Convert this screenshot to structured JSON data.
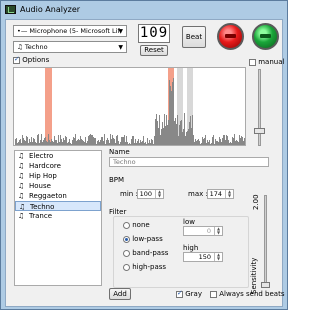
{
  "window": {
    "title": "Audio Analyzer"
  },
  "toolbar": {
    "input_device": "Microphone (5- Microsoft Lif",
    "bpm_display": "109",
    "reset_label": "Reset",
    "beat_label": "Beat",
    "genre_selected": "Techno",
    "options_label": "Options",
    "manual_label": "manual"
  },
  "indicators": {
    "left_led": "red",
    "right_led": "green"
  },
  "genres": [
    "Electro",
    "Hardcore",
    "Hip Hop",
    "House",
    "Reggaeton",
    "Techno",
    "Trance"
  ],
  "selected_genre_index": 5,
  "settings": {
    "name_label": "Name",
    "name_value": "Techno",
    "bpm_label": "BPM",
    "min_label": "min :",
    "min_value": "100",
    "max_label": "max :",
    "max_value": "174",
    "filter_label": "Filter",
    "filters": [
      "none",
      "low-pass",
      "band-pass",
      "high-pass"
    ],
    "selected_filter_index": 1,
    "low_label": "low",
    "low_value": "0",
    "high_label": "high",
    "high_value": "150",
    "sensitivity_value": "2.00",
    "sensitivity_label": "Sensitivity"
  },
  "footer": {
    "add_label": "Add",
    "gray_label": "Gray",
    "always_send_label": "Always send beats"
  },
  "colors": {
    "accent": "#2a5daa",
    "peak": "#f08060",
    "band": "#d0d0d0",
    "red_led": "#e81b1b",
    "green_led": "#1aa63a"
  }
}
